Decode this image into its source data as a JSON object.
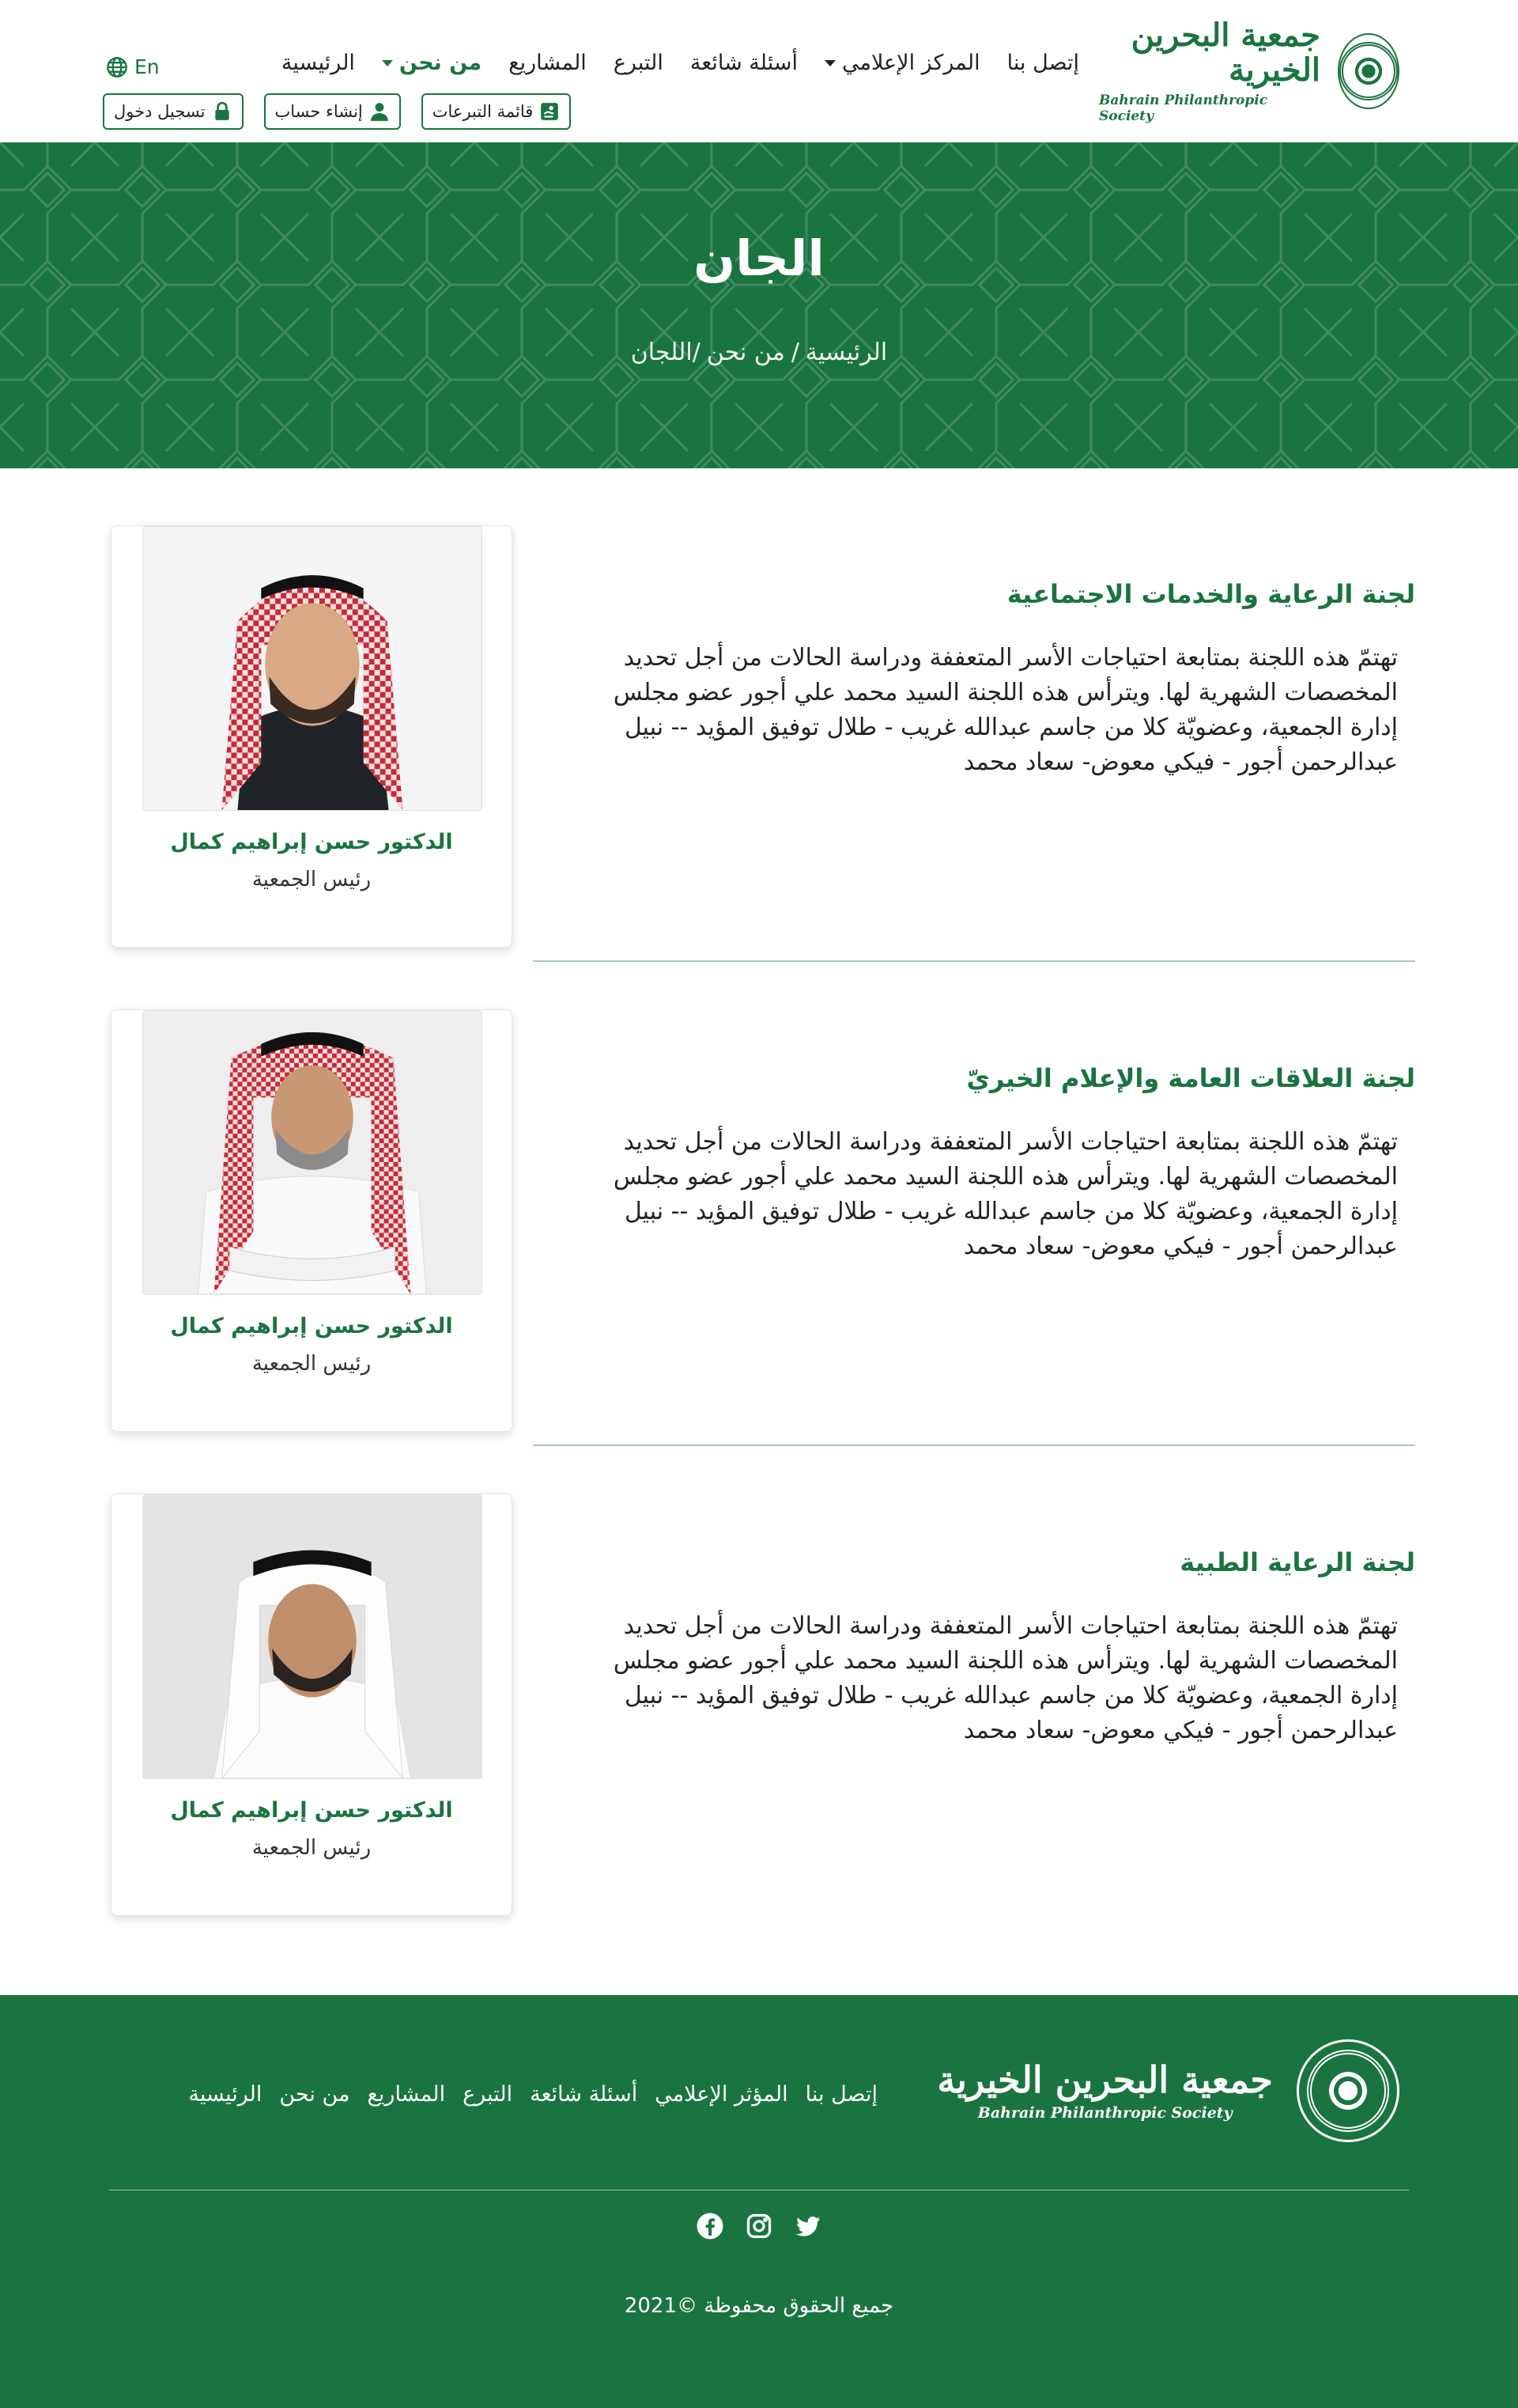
{
  "header": {
    "logo_ar": "جمعية البحرين الخيرية",
    "logo_en": "Bahrain Philanthropic Society",
    "nav": [
      {
        "label": "الرئيسية"
      },
      {
        "label": "من نحن"
      },
      {
        "label": "المشاريع"
      },
      {
        "label": "التبرع"
      },
      {
        "label": "أسئلة شائعة"
      },
      {
        "label": "المركز الإعلامي"
      },
      {
        "label": "إتصل بنا"
      }
    ],
    "lang_label": "En",
    "buttons": {
      "donations_list": "قائمة التبرعات",
      "create_account": "إنشاء حساب",
      "login": "تسجيل دخول"
    }
  },
  "banner": {
    "title": "الجان",
    "breadcrumb_home": "الرئيسية",
    "breadcrumb_sep": "/",
    "breadcrumb_about": "من نحن",
    "breadcrumb_current": "/اللجان"
  },
  "committees": [
    {
      "title": "لجنة الرعاية والخدمات الاجتماعية",
      "description": "تهتمّ هذه اللجنة بمتابعة احتياجات الأسر المتعففة ودراسة الحالات من أجل تحديد المخصصات الشهرية لها. ويترأس هذه اللجنة السيد محمد علي أجور عضو مجلس إدارة الجمعية، وعضويّة كلا من جاسم عبدالله غريب - طلال توفيق المؤيد -- نبيل عبدالرحمن أجور - فيكي معوض- سعاد محمد",
      "member_name": "الدكتور حسن إبراهيم كمال",
      "member_role": "رئيس الجمعية"
    },
    {
      "title": "لجنة العلاقات العامة والإعلام الخيريّ",
      "description": "تهتمّ هذه اللجنة بمتابعة احتياجات الأسر المتعففة ودراسة الحالات من أجل تحديد المخصصات الشهرية لها. ويترأس هذه اللجنة السيد محمد علي أجور عضو مجلس إدارة الجمعية، وعضويّة كلا من جاسم عبدالله غريب - طلال توفيق المؤيد -- نبيل عبدالرحمن أجور - فيكي معوض- سعاد محمد",
      "member_name": "الدكتور حسن إبراهيم كمال",
      "member_role": "رئيس الجمعية"
    },
    {
      "title": "لجنة الرعاية الطبية",
      "description": "تهتمّ هذه اللجنة بمتابعة احتياجات الأسر المتعففة ودراسة الحالات من أجل تحديد المخصصات الشهرية لها. ويترأس هذه اللجنة السيد محمد علي أجور عضو مجلس إدارة الجمعية، وعضويّة كلا من جاسم عبدالله غريب - طلال توفيق المؤيد -- نبيل عبدالرحمن أجور - فيكي معوض- سعاد محمد",
      "member_name": "الدكتور حسن إبراهيم كمال",
      "member_role": "رئيس الجمعية"
    }
  ],
  "footer": {
    "logo_ar": "جمعية البحرين الخيرية",
    "logo_en": "Bahrain Philanthropic Society",
    "nav": [
      {
        "label": "الرئيسية"
      },
      {
        "label": "من نحن"
      },
      {
        "label": "المشاريع"
      },
      {
        "label": "التبرع"
      },
      {
        "label": "أسئلة شائعة"
      },
      {
        "label": "المؤثر الإعلامي"
      },
      {
        "label": "إتصل بنا"
      }
    ],
    "socials": [
      "twitter-icon",
      "instagram-icon",
      "facebook-icon"
    ],
    "copyright": "جميع الحقوق محفوظة ©2021"
  },
  "theme": {
    "brand_green": "#1a7440",
    "divider_green": "#a7cbb4"
  }
}
